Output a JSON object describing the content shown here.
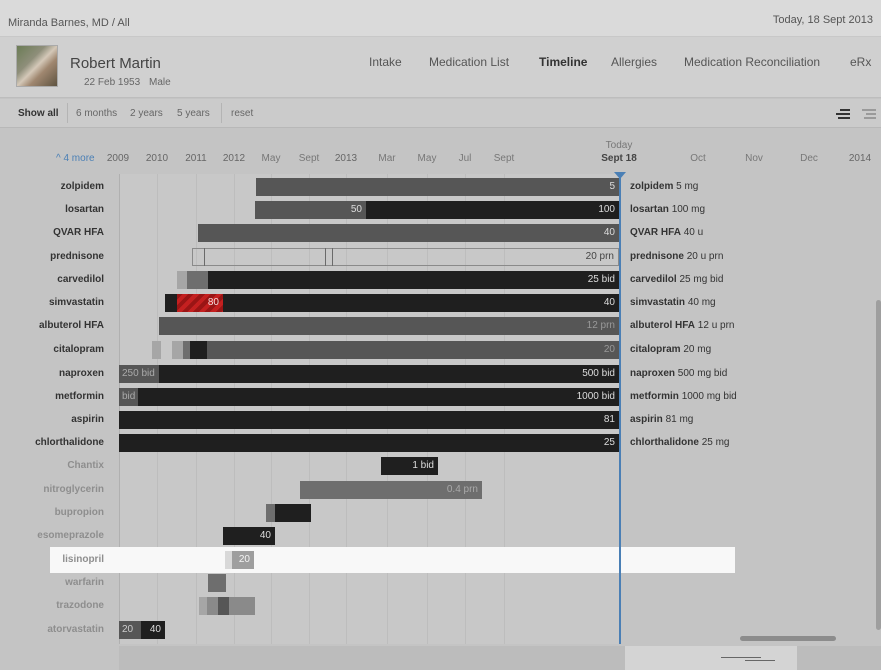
{
  "header": {
    "breadcrumb": "Miranda Barnes, MD / All",
    "date": "Today, 18 Sept 2013"
  },
  "patient": {
    "name": "Robert Martin",
    "dob": "22 Feb 1953",
    "sex": "Male"
  },
  "nav": [
    "Intake",
    "Medication List",
    "Timeline",
    "Allergies",
    "Medication Reconciliation",
    "eRx"
  ],
  "nav_active": "Timeline",
  "filters": {
    "show_all": "Show all",
    "six_months": "6 months",
    "two_years": "2 years",
    "five_years": "5 years",
    "reset": "reset"
  },
  "view_icons": [
    "bars-view-icon",
    "list-view-icon"
  ],
  "axis": {
    "more": "^  4 more",
    "today_label": "Today",
    "ticks": [
      "2009",
      "2010",
      "2011",
      "2012",
      "May",
      "Sept",
      "2013",
      "Mar",
      "May",
      "Jul",
      "Sept",
      "Sept 18",
      "Oct",
      "Nov",
      "Dec",
      "2014"
    ]
  },
  "colors": {
    "today_line": "#4a7fb5",
    "bar_active": "#1f1f1f",
    "bar_mid": "#565656",
    "warning": "#c42020",
    "highlight": "#f8f8f8"
  },
  "rows": [
    {
      "label": "zolpidem",
      "bar_label": "5",
      "dose_name": "zolpidem",
      "dose": "5 mg"
    },
    {
      "label": "losartan",
      "bar_label": "100",
      "bar_label_2": "50",
      "dose_name": "losartan",
      "dose": "100 mg"
    },
    {
      "label": "QVAR HFA",
      "bar_label": "40",
      "dose_name": "QVAR HFA",
      "dose": "40 u"
    },
    {
      "label": "prednisone",
      "bar_label": "20 prn",
      "dose_name": "prednisone",
      "dose": "20 u prn"
    },
    {
      "label": "carvedilol",
      "bar_label": "25 bid",
      "dose_name": "carvedilol",
      "dose": "25 mg bid"
    },
    {
      "label": "simvastatin",
      "bar_label": "40",
      "bar_label_2": "80",
      "dose_name": "simvastatin",
      "dose": "40 mg"
    },
    {
      "label": "albuterol HFA",
      "bar_label": "12 prn",
      "dose_name": "albuterol HFA",
      "dose": "12 u prn"
    },
    {
      "label": "citalopram",
      "bar_label": "20",
      "dose_name": "citalopram",
      "dose": "20 mg"
    },
    {
      "label": "naproxen",
      "bar_label": "500 bid",
      "bar_label_2": "250 bid",
      "dose_name": "naproxen",
      "dose": "500 mg bid"
    },
    {
      "label": "metformin",
      "bar_label": "1000 bid",
      "bar_label_2": "bid",
      "dose_name": "metformin",
      "dose": "1000 mg bid"
    },
    {
      "label": "aspirin",
      "bar_label": "81",
      "dose_name": "aspirin",
      "dose": "81 mg"
    },
    {
      "label": "chlorthalidone",
      "bar_label": "25",
      "dose_name": "chlorthalidone",
      "dose": "25 mg"
    },
    {
      "label": "Chantix",
      "bar_label": "1 bid"
    },
    {
      "label": "nitroglycerin",
      "bar_label": "0.4 prn"
    },
    {
      "label": "bupropion"
    },
    {
      "label": "esomeprazole",
      "bar_label": "40"
    },
    {
      "label": "lisinopril",
      "bar_label": "20"
    },
    {
      "label": "warfarin"
    },
    {
      "label": "trazodone"
    },
    {
      "label": "atorvastatin",
      "bar_label": "40",
      "bar_label_2": "20"
    }
  ]
}
